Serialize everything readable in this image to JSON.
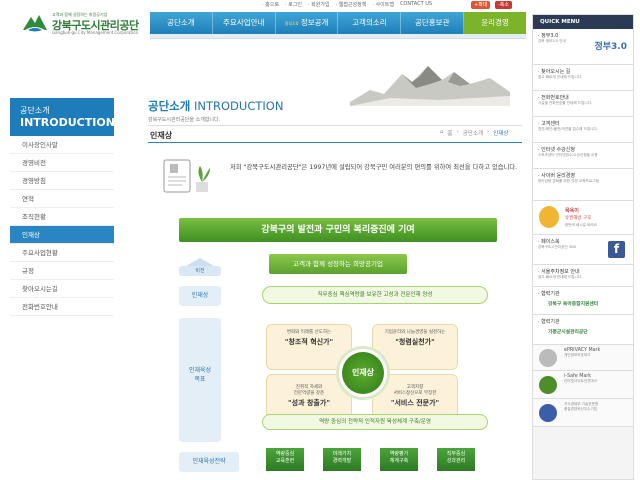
{
  "header": {
    "logo": {
      "tagline": "고객과 함께 성장하는 희망공기업",
      "name": "강북구도시관리공단",
      "name_en": "Gangbuk-gu City Management Corporation"
    },
    "util_links": [
      "· 홈으로",
      "· 로그인",
      "· 회원가입",
      "· 웹접근성정책",
      "· 사이트맵",
      "CONTACT US"
    ],
    "font_plus": "+확대",
    "font_minus": "-축소"
  },
  "gnb": {
    "items": [
      {
        "label": "공단소개"
      },
      {
        "label": "주요사업안내"
      },
      {
        "label": "정보공개",
        "prefix": "정부3.0"
      },
      {
        "label": "고객의소리"
      },
      {
        "label": "공단홍보관"
      },
      {
        "label": "윤리경영"
      }
    ]
  },
  "lnb": {
    "title_ko": "공단소개",
    "title_en": "INTRODUCTION",
    "items": [
      "이사장인사말",
      "경영비전",
      "경영방침",
      "연혁",
      "조직현황",
      "인재상",
      "주요사업현황",
      "규정",
      "찾아오시는길",
      "전화번호안내"
    ],
    "active_index": 5
  },
  "content": {
    "section_ko": "공단소개",
    "section_en": "INTRODUCTION",
    "section_desc": "강북구도시관리공단을 소개합니다.",
    "page_title": "인재상",
    "breadcrumb": [
      "홈",
      "공단소개",
      "인재상"
    ],
    "intro_prefix": "저희 ",
    "intro_quote": "\"강북구도시관리공단\"",
    "intro_rest": "은 1997년에 설립되어 강북구민 여러분의 편의를 위하여 최선을 다하고 있습니다."
  },
  "diagram": {
    "top_banner": "강북구의 발전과 구민의 복리증진에 기여",
    "vision_label": "비전",
    "vision_text": "고객과 함께 성장하는 희망공기업",
    "talent_label": "인재상",
    "talent_text": "직무중심 핵심역량을 보유한 고성과 전문인재 양성",
    "dev_goal_label": "인재육성\n목표",
    "center": "인재상",
    "quads": [
      {
        "desc": "변화와 미래를 선도하는",
        "title": "\"창조적 혁신가\""
      },
      {
        "desc": "기업윤리와 나눔경영을 실천하는",
        "title": "\"청렴실천가\""
      },
      {
        "desc": "진취적 자세와\n전문역량을 갖춘",
        "title": "\"성과 창출가\""
      },
      {
        "desc": "고객지향\n서비스정신으로 무장한",
        "title": "\"서비스 전문가\""
      }
    ],
    "bottom_text": "역량 중심의 전략적 인적자원 육성체계 구축/운영",
    "strategy_label": "인재육성전략",
    "strategies": [
      "역량중심\n교육훈련",
      "미래가치\n경력개발",
      "역량평가\n체계구축",
      "직무중심\n성과관리"
    ]
  },
  "quick": {
    "title": "QUICK MENU",
    "items": [
      {
        "title": "· 정부3.0",
        "desc": "강북 정보3.0 안내",
        "logo": "정부3.0"
      },
      {
        "title": "· 찾아오시는 길",
        "desc": "쉽고 빠르게 안내해 드립니다."
      },
      {
        "title": "· 전화번호안내",
        "desc": "시설별 전화번호를 안내해 드립니다."
      },
      {
        "title": "· 고객센터",
        "desc": "칭찬/제안/불만/의견을 접수해 드립니다."
      },
      {
        "title": "· 인터넷 수강신청",
        "desc": "스포츠센터 인터넷접수/수강신청을 이용"
      },
      {
        "title": "· 사이버 윤리경영",
        "desc": "윤리강령 강화를 위한 직장 교육프로그램"
      },
      {
        "title": "",
        "desc": "",
        "badge_title": "목욕이",
        "badge_desc": "유권해방 구호",
        "badge_extra": "한번씩 배시길 바라요"
      },
      {
        "title": "· 페이스북",
        "desc": "강북구도시관리공단 SNS"
      },
      {
        "title": "· 서울주차정보 안내",
        "desc": "쉽고 빠르게 안내해 드립니다."
      },
      {
        "title": "· 협력기관",
        "desc": "",
        "partner": "강북구 육아종합지원센터"
      },
      {
        "title": "· 협력기관",
        "desc": "",
        "partner": "가평군시설관리공단"
      },
      {
        "title": "ePRIVACY Mark",
        "desc": "개인정보보호마크"
      },
      {
        "title": "i-Safe Mark",
        "desc": "인터넷사이트안전마크"
      },
      {
        "title": "",
        "desc": "지식경제부 기술표준원\n품질경영혁신우수기업"
      }
    ]
  },
  "colors": {
    "primary_blue": "#1d7cb9",
    "green": "#4a9a2a",
    "quick_header": "#2b3a55"
  }
}
